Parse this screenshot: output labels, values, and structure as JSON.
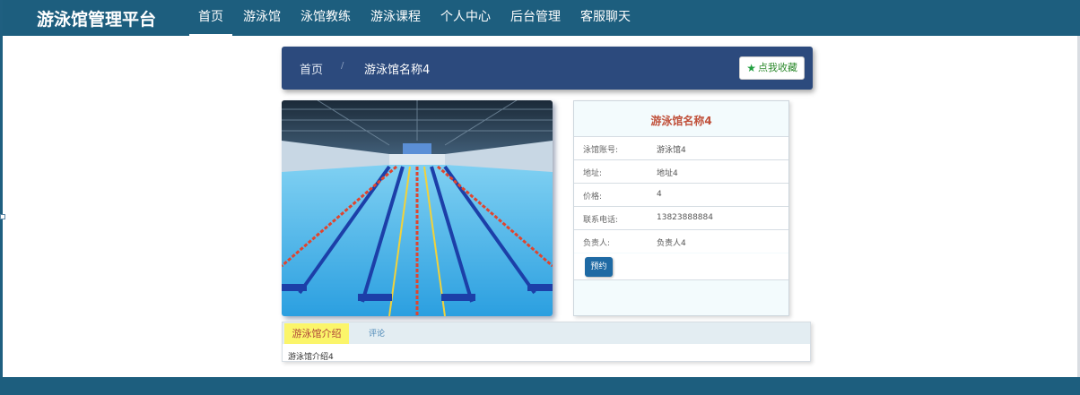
{
  "brand": "游泳馆管理平台",
  "nav": {
    "items": [
      {
        "label": "首页",
        "active": true
      },
      {
        "label": "游泳馆",
        "active": false
      },
      {
        "label": "泳馆教练",
        "active": false
      },
      {
        "label": "游泳课程",
        "active": false
      },
      {
        "label": "个人中心",
        "active": false
      },
      {
        "label": "后台管理",
        "active": false
      },
      {
        "label": "客服聊天",
        "active": false
      }
    ]
  },
  "breadcrumb": {
    "home": "首页",
    "separator": "/",
    "current": "游泳馆名称4"
  },
  "favorite_label": "点我收藏",
  "detail": {
    "title": "游泳馆名称4",
    "fields": [
      {
        "label": "泳馆账号:",
        "value": "游泳馆4"
      },
      {
        "label": "地址:",
        "value": "地址4"
      },
      {
        "label": "价格:",
        "value": "4"
      },
      {
        "label": "联系电话:",
        "value": "13823888884"
      },
      {
        "label": "负责人:",
        "value": "负责人4"
      }
    ],
    "book_label": "预约"
  },
  "tabs": {
    "intro_label": "游泳馆介绍",
    "review_label": "评论",
    "intro_content": "游泳馆介绍4"
  },
  "colors": {
    "navbar": "#1d5e7e",
    "breadcrumb_bar": "#2c4a7d",
    "title_red": "#c0503a",
    "book_button": "#1e6aa4",
    "tab_active": "#fbf56a"
  }
}
